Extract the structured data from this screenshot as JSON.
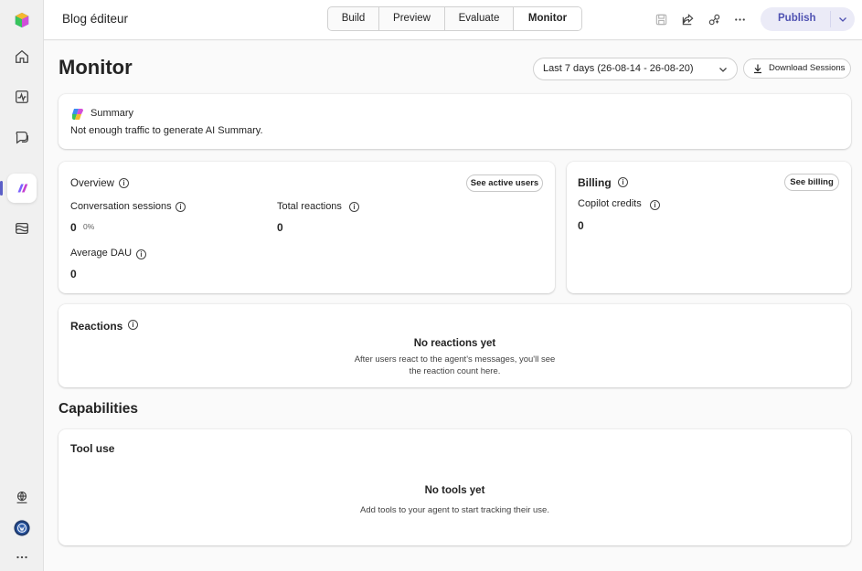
{
  "window": {
    "app_title": "Blog éditeur"
  },
  "tabs": [
    {
      "label": "Build",
      "selected": false
    },
    {
      "label": "Preview",
      "selected": false
    },
    {
      "label": "Evaluate",
      "selected": false
    },
    {
      "label": "Monitor",
      "selected": true
    }
  ],
  "toolbar": {
    "icons": [
      "save-icon",
      "share-icon",
      "link-icon",
      "more-icon"
    ],
    "publish_label": "Publish"
  },
  "rail": {
    "icons": [
      "copilot-studio-logo-icon",
      "home-icon",
      "activity-icon",
      "chat-icon",
      "agent-icon",
      "library-icon",
      "globe-icon",
      "user-avatar-icon",
      "more-icon"
    ],
    "active": "agent-icon"
  },
  "page": {
    "title": "Monitor",
    "date_range": "Last 7 days (26-08-14 - 26-08-20)",
    "download_label": "Download Sessions"
  },
  "summary": {
    "title": "Summary",
    "text": "Not enough traffic to generate AI Summary."
  },
  "overview": {
    "title": "Overview",
    "see_active_users": "See active users",
    "conversation_sessions": {
      "label": "Conversation sessions",
      "value": "0",
      "change": "0%"
    },
    "total_reactions": {
      "label": "Total reactions",
      "value": "0"
    },
    "average_dau": {
      "label": "Average DAU",
      "value": "0"
    }
  },
  "billing": {
    "title": "Billing",
    "see_billing": "See billing",
    "copilot_credits": {
      "label": "Copilot credits",
      "value": "0"
    }
  },
  "reactions": {
    "title": "Reactions",
    "empty_title": "No reactions yet",
    "empty_line1": "After users react to the agent's messages, you'll see",
    "empty_line2": "the reaction count here."
  },
  "capabilities": {
    "title": "Capabilities",
    "tool_use": {
      "title": "Tool use",
      "empty_title": "No tools yet",
      "empty_desc": "Add tools to your agent to start tracking their use."
    }
  },
  "colors": {
    "accent": "#5b5fc7",
    "publish_bg": "#ebebf7",
    "publish_text": "#4f52b2"
  }
}
